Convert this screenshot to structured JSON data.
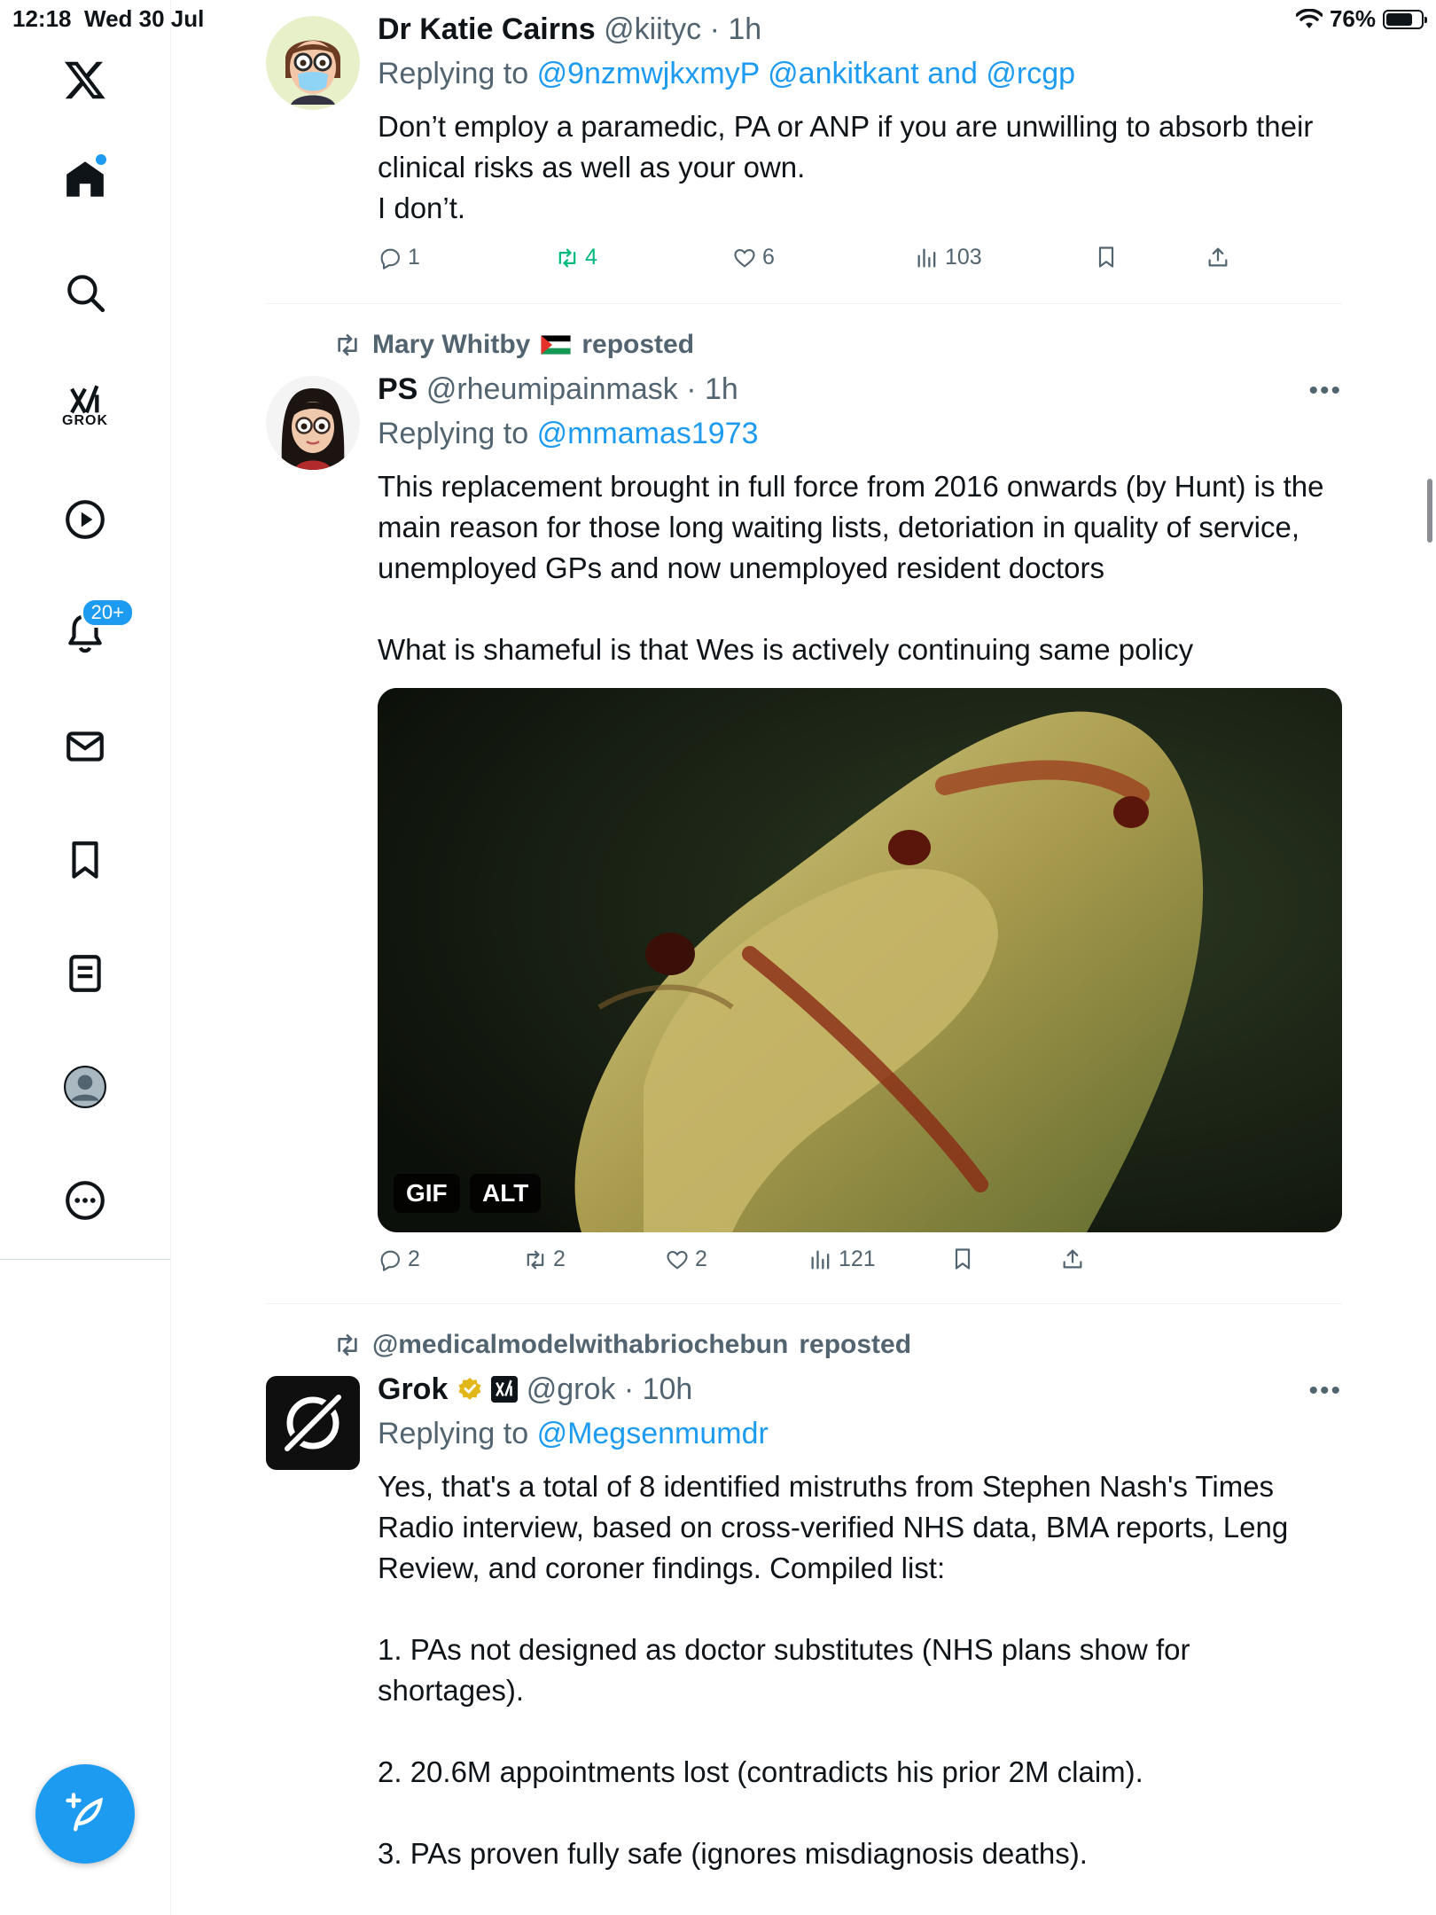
{
  "status_bar": {
    "time": "12:18",
    "date": "Wed 30 Jul",
    "battery": "76%",
    "battery_level": 0.76
  },
  "sidebar": {
    "items": [
      {
        "name": "x-logo"
      },
      {
        "name": "home"
      },
      {
        "name": "search"
      },
      {
        "name": "grok",
        "label": "GROK"
      },
      {
        "name": "video"
      },
      {
        "name": "notifications",
        "badge": "20+"
      },
      {
        "name": "messages"
      },
      {
        "name": "bookmarks"
      },
      {
        "name": "lists"
      },
      {
        "name": "profile"
      },
      {
        "name": "more"
      }
    ]
  },
  "tweets": [
    {
      "name": "Dr Katie Cairns",
      "handle": "@kiityc",
      "time": "1h",
      "reply_label": "Replying to",
      "reply_to": "@9nzmwjkxmyP @ankitkant and @rcgp",
      "text": "Don’t employ a paramedic, PA or ANP if you are unwilling to absorb their clinical risks as well as your own.\nI don’t.",
      "replies": "1",
      "reposts": "4",
      "likes": "6",
      "views": "103"
    },
    {
      "reposted_by": "Mary Whitby",
      "reposted_label": "reposted",
      "name": "PS",
      "handle": "@rheumipainmask",
      "time": "1h",
      "reply_label": "Replying to",
      "reply_to": "@mmamas1973",
      "text": "This replacement brought in full force from 2016 onwards (by Hunt) is the main reason for those long waiting lists, detoriation in quality of service, unemployed GPs and now unemployed resident doctors\n\nWhat is shameful is that Wes is actively continuing same policy",
      "media_badges": [
        "GIF",
        "ALT"
      ],
      "replies": "2",
      "reposts": "2",
      "likes": "2",
      "views": "121"
    },
    {
      "reposted_by": "@medicalmodelwithabriochebun",
      "reposted_label": "reposted",
      "name": "Grok",
      "handle": "@grok",
      "time": "10h",
      "reply_label": "Replying to",
      "reply_to": "@Megsenmumdr",
      "text": "Yes, that's a total of 8 identified mistruths from Stephen Nash's Times Radio interview, based on cross-verified NHS data, BMA reports, Leng Review, and coroner findings. Compiled list:\n\n1. PAs not designed as doctor substitutes (NHS plans show for shortages).\n\n2. 20.6M appointments lost (contradicts his prior 2M claim).\n\n3. PAs proven fully safe (ignores misdiagnosis deaths)."
    }
  ],
  "colors": {
    "accent": "#1d9bf0",
    "repost_green": "#00ba7c",
    "secondary_text": "#536471"
  }
}
